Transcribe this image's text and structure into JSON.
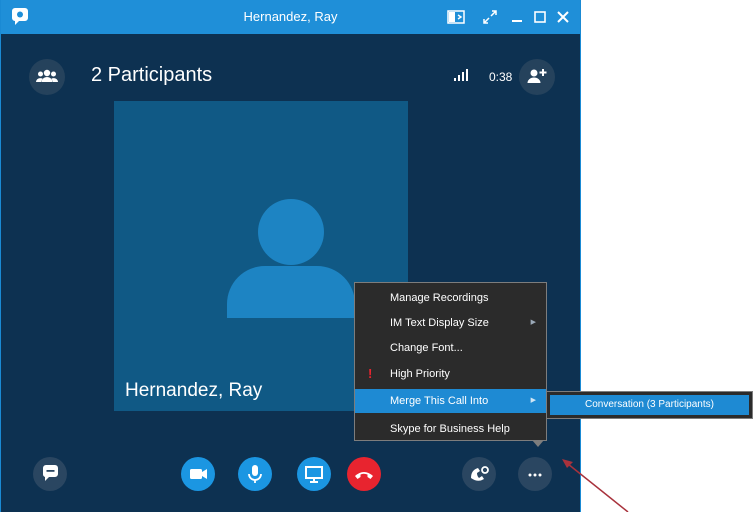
{
  "window": {
    "title": "Hernandez, Ray",
    "controls": [
      "dock-icon",
      "expand-icon",
      "minimize-icon",
      "maximize-icon",
      "close-icon"
    ]
  },
  "header": {
    "participants_label": "2 Participants",
    "call_timer": "0:38"
  },
  "tile": {
    "caller_name": "Hernandez, Ray"
  },
  "menu": {
    "items": [
      {
        "label": "Manage Recordings"
      },
      {
        "label": "IM Text Display Size"
      },
      {
        "label": "Change Font..."
      },
      {
        "label": "High Priority"
      },
      {
        "label": "Merge This Call Into"
      },
      {
        "label": "Skype for Business Help"
      }
    ]
  },
  "submenu": {
    "items": [
      {
        "label": "Conversation (3 Participants)"
      }
    ]
  },
  "controls": [
    "im-icon",
    "video-icon",
    "mic-icon",
    "present-icon",
    "hangup-icon",
    "call-controls-icon",
    "more-options-icon"
  ],
  "colors": {
    "titlebar": "#1f8fd8",
    "window_bg": "#0d3151",
    "tile_bg": "#105985",
    "highlight": "#1e8ad3",
    "hangup": "#e8242f",
    "annotation_arrow": "#a8323c"
  }
}
